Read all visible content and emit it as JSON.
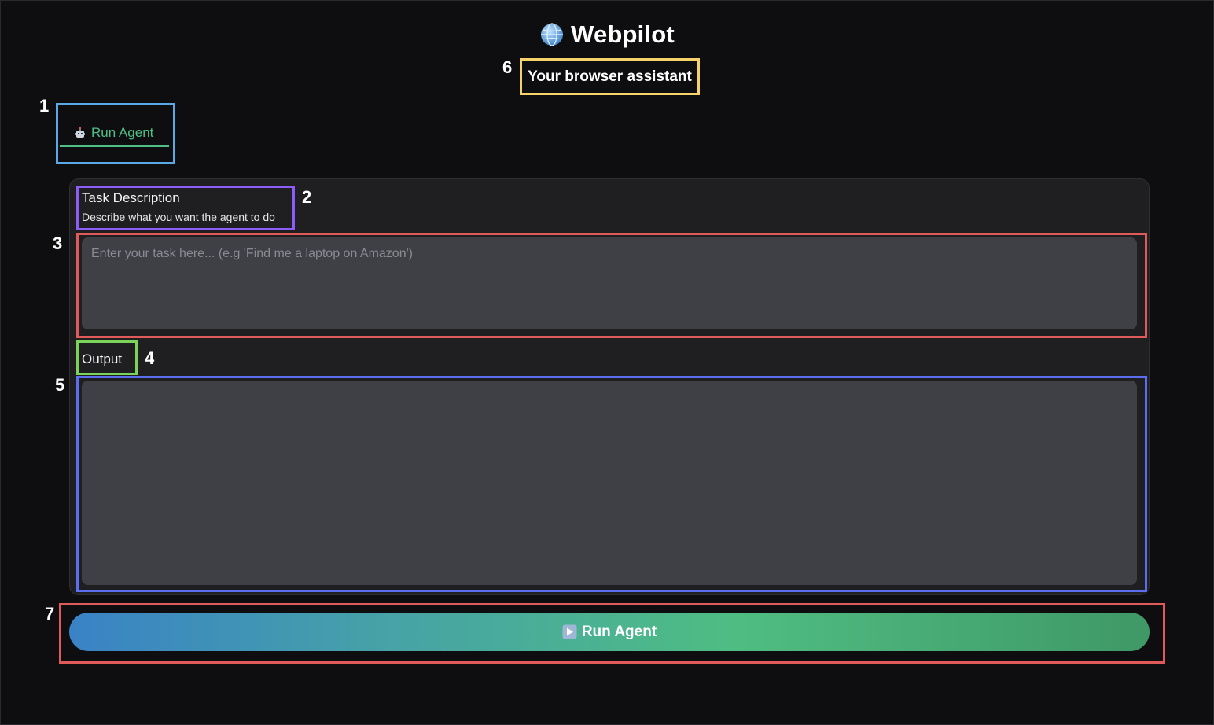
{
  "app": {
    "title": "Webpilot",
    "subtitle": "Your browser assistant",
    "title_icon": "globe-icon"
  },
  "tabs": [
    {
      "label": "Run Agent",
      "icon": "robot-icon",
      "active": true
    }
  ],
  "task": {
    "label": "Task Description",
    "info": "Describe what you want the agent to do",
    "placeholder": "Enter your task here... (e.g 'Find me a laptop on Amazon')",
    "value": ""
  },
  "output": {
    "label": "Output",
    "value": ""
  },
  "run_button": {
    "label": "Run Agent",
    "icon": "play-icon"
  },
  "colors": {
    "background": "#0e0e10",
    "panel": "#1f1f22",
    "input": "#3f3f46",
    "accent_green": "#4fbf86",
    "gradient_start": "#3a82c6",
    "gradient_end": "#3f9866"
  },
  "annotations": [
    {
      "number": "1",
      "target": "tab-run-agent",
      "color": "#5aa9e6"
    },
    {
      "number": "2",
      "target": "task-description-label",
      "color": "#8b5cf6"
    },
    {
      "number": "3",
      "target": "task-input",
      "color": "#e05a5a"
    },
    {
      "number": "4",
      "target": "output-label",
      "color": "#7bd35a"
    },
    {
      "number": "5",
      "target": "output-box",
      "color": "#5b6ef0"
    },
    {
      "number": "6",
      "target": "subtitle",
      "color": "#f5d36a"
    },
    {
      "number": "7",
      "target": "run-agent-button",
      "color": "#e05a5a"
    }
  ]
}
